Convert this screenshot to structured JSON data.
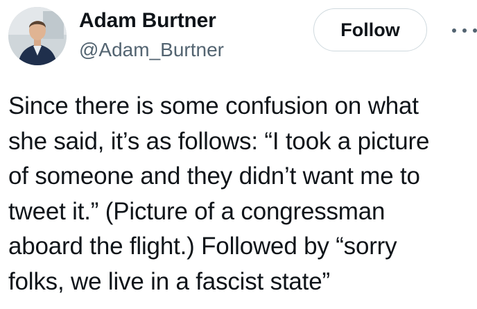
{
  "author": {
    "display_name": "Adam Burtner",
    "handle": "@Adam_Burtner",
    "avatar_icon": "avatar-photo"
  },
  "actions": {
    "follow_label": "Follow",
    "more_icon": "more-horizontal-icon"
  },
  "tweet": {
    "lines": [
      "Since there is some confusion on what",
      "she said, it’s as follows: “I took a picture",
      "of someone and they didn’t want me to",
      "tweet it.” (Picture of a congressman",
      "aboard the flight.) Followed by “sorry",
      "folks, we live in a fascist state”"
    ]
  },
  "colors": {
    "text": "#0f1419",
    "secondary_text": "#536471",
    "button_border": "#cfd9de"
  }
}
